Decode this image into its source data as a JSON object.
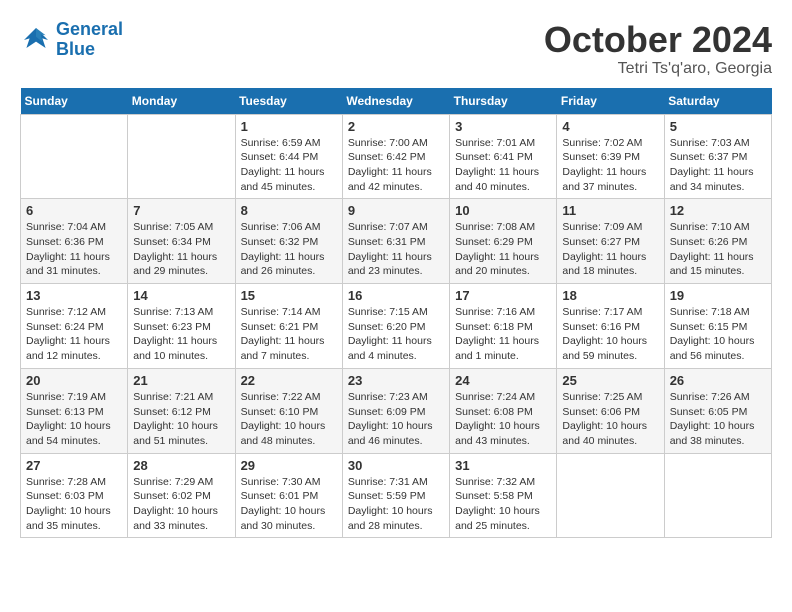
{
  "logo": {
    "line1": "General",
    "line2": "Blue"
  },
  "title": "October 2024",
  "location": "Tetri Ts'q'aro, Georgia",
  "weekdays": [
    "Sunday",
    "Monday",
    "Tuesday",
    "Wednesday",
    "Thursday",
    "Friday",
    "Saturday"
  ],
  "weeks": [
    [
      {
        "day": "",
        "detail": ""
      },
      {
        "day": "",
        "detail": ""
      },
      {
        "day": "1",
        "detail": "Sunrise: 6:59 AM\nSunset: 6:44 PM\nDaylight: 11 hours and 45 minutes."
      },
      {
        "day": "2",
        "detail": "Sunrise: 7:00 AM\nSunset: 6:42 PM\nDaylight: 11 hours and 42 minutes."
      },
      {
        "day": "3",
        "detail": "Sunrise: 7:01 AM\nSunset: 6:41 PM\nDaylight: 11 hours and 40 minutes."
      },
      {
        "day": "4",
        "detail": "Sunrise: 7:02 AM\nSunset: 6:39 PM\nDaylight: 11 hours and 37 minutes."
      },
      {
        "day": "5",
        "detail": "Sunrise: 7:03 AM\nSunset: 6:37 PM\nDaylight: 11 hours and 34 minutes."
      }
    ],
    [
      {
        "day": "6",
        "detail": "Sunrise: 7:04 AM\nSunset: 6:36 PM\nDaylight: 11 hours and 31 minutes."
      },
      {
        "day": "7",
        "detail": "Sunrise: 7:05 AM\nSunset: 6:34 PM\nDaylight: 11 hours and 29 minutes."
      },
      {
        "day": "8",
        "detail": "Sunrise: 7:06 AM\nSunset: 6:32 PM\nDaylight: 11 hours and 26 minutes."
      },
      {
        "day": "9",
        "detail": "Sunrise: 7:07 AM\nSunset: 6:31 PM\nDaylight: 11 hours and 23 minutes."
      },
      {
        "day": "10",
        "detail": "Sunrise: 7:08 AM\nSunset: 6:29 PM\nDaylight: 11 hours and 20 minutes."
      },
      {
        "day": "11",
        "detail": "Sunrise: 7:09 AM\nSunset: 6:27 PM\nDaylight: 11 hours and 18 minutes."
      },
      {
        "day": "12",
        "detail": "Sunrise: 7:10 AM\nSunset: 6:26 PM\nDaylight: 11 hours and 15 minutes."
      }
    ],
    [
      {
        "day": "13",
        "detail": "Sunrise: 7:12 AM\nSunset: 6:24 PM\nDaylight: 11 hours and 12 minutes."
      },
      {
        "day": "14",
        "detail": "Sunrise: 7:13 AM\nSunset: 6:23 PM\nDaylight: 11 hours and 10 minutes."
      },
      {
        "day": "15",
        "detail": "Sunrise: 7:14 AM\nSunset: 6:21 PM\nDaylight: 11 hours and 7 minutes."
      },
      {
        "day": "16",
        "detail": "Sunrise: 7:15 AM\nSunset: 6:20 PM\nDaylight: 11 hours and 4 minutes."
      },
      {
        "day": "17",
        "detail": "Sunrise: 7:16 AM\nSunset: 6:18 PM\nDaylight: 11 hours and 1 minute."
      },
      {
        "day": "18",
        "detail": "Sunrise: 7:17 AM\nSunset: 6:16 PM\nDaylight: 10 hours and 59 minutes."
      },
      {
        "day": "19",
        "detail": "Sunrise: 7:18 AM\nSunset: 6:15 PM\nDaylight: 10 hours and 56 minutes."
      }
    ],
    [
      {
        "day": "20",
        "detail": "Sunrise: 7:19 AM\nSunset: 6:13 PM\nDaylight: 10 hours and 54 minutes."
      },
      {
        "day": "21",
        "detail": "Sunrise: 7:21 AM\nSunset: 6:12 PM\nDaylight: 10 hours and 51 minutes."
      },
      {
        "day": "22",
        "detail": "Sunrise: 7:22 AM\nSunset: 6:10 PM\nDaylight: 10 hours and 48 minutes."
      },
      {
        "day": "23",
        "detail": "Sunrise: 7:23 AM\nSunset: 6:09 PM\nDaylight: 10 hours and 46 minutes."
      },
      {
        "day": "24",
        "detail": "Sunrise: 7:24 AM\nSunset: 6:08 PM\nDaylight: 10 hours and 43 minutes."
      },
      {
        "day": "25",
        "detail": "Sunrise: 7:25 AM\nSunset: 6:06 PM\nDaylight: 10 hours and 40 minutes."
      },
      {
        "day": "26",
        "detail": "Sunrise: 7:26 AM\nSunset: 6:05 PM\nDaylight: 10 hours and 38 minutes."
      }
    ],
    [
      {
        "day": "27",
        "detail": "Sunrise: 7:28 AM\nSunset: 6:03 PM\nDaylight: 10 hours and 35 minutes."
      },
      {
        "day": "28",
        "detail": "Sunrise: 7:29 AM\nSunset: 6:02 PM\nDaylight: 10 hours and 33 minutes."
      },
      {
        "day": "29",
        "detail": "Sunrise: 7:30 AM\nSunset: 6:01 PM\nDaylight: 10 hours and 30 minutes."
      },
      {
        "day": "30",
        "detail": "Sunrise: 7:31 AM\nSunset: 5:59 PM\nDaylight: 10 hours and 28 minutes."
      },
      {
        "day": "31",
        "detail": "Sunrise: 7:32 AM\nSunset: 5:58 PM\nDaylight: 10 hours and 25 minutes."
      },
      {
        "day": "",
        "detail": ""
      },
      {
        "day": "",
        "detail": ""
      }
    ]
  ]
}
